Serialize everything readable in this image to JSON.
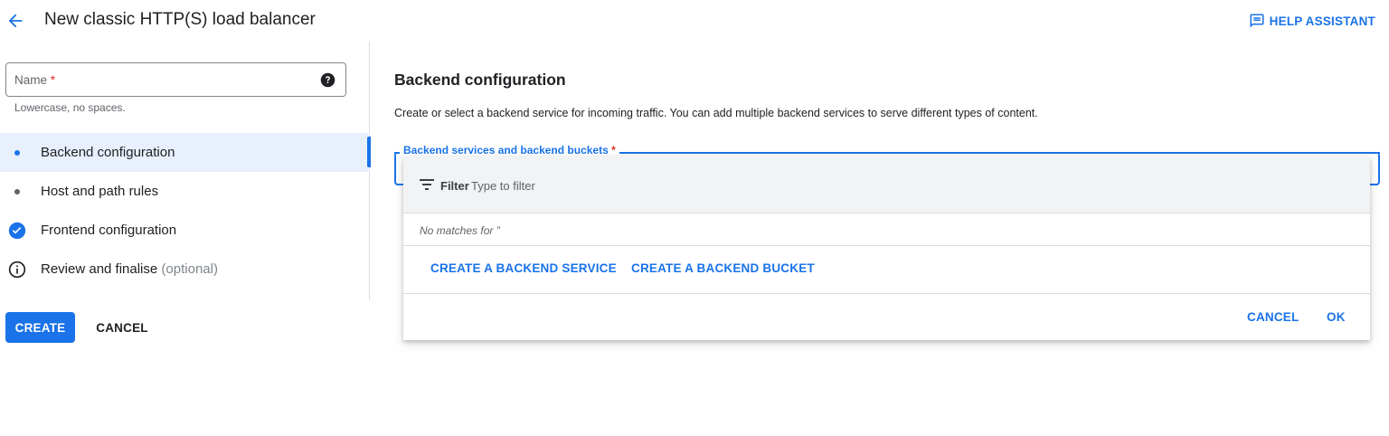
{
  "header": {
    "title": "New classic HTTP(S) load balancer",
    "help_label": "HELP ASSISTANT",
    "back_icon": "arrow-left-icon",
    "help_icon": "feedback-icon"
  },
  "form": {
    "name_label": "Name",
    "required_mark": "*",
    "name_value": "",
    "name_hint": "Lowercase, no spaces."
  },
  "steps": [
    {
      "label": "Backend configuration",
      "state": "active",
      "icon": "dot-icon"
    },
    {
      "label": "Host and path rules",
      "state": "pending",
      "icon": "dot-icon"
    },
    {
      "label": "Frontend configuration",
      "state": "complete",
      "icon": "check-circle-icon"
    },
    {
      "label": "Review and finalise",
      "optional": "(optional)",
      "state": "info",
      "icon": "info-icon"
    }
  ],
  "actions": {
    "create": "CREATE",
    "cancel": "CANCEL"
  },
  "main": {
    "title": "Backend configuration",
    "description": "Create or select a backend service for incoming traffic. You can add multiple backend services to serve different types of content.",
    "select_label": "Backend services and backend buckets",
    "required_mark": "*"
  },
  "dropdown": {
    "filter_label": "Filter",
    "filter_placeholder": "Type to filter",
    "filter_value": "",
    "no_matches": "No matches for ”",
    "create_service": "CREATE A BACKEND SERVICE",
    "create_bucket": "CREATE A BACKEND BUCKET",
    "cancel": "CANCEL",
    "ok": "OK"
  },
  "colors": {
    "accent": "#1a73e8",
    "required": "#d93025",
    "active_step_bg": "#e8f0fe"
  }
}
